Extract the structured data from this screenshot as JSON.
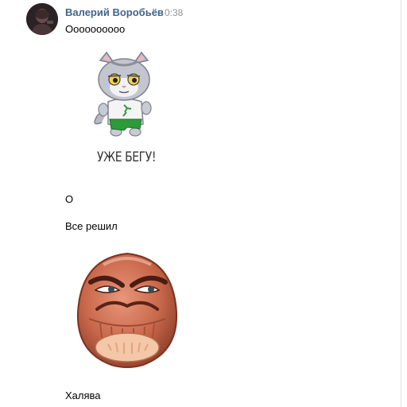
{
  "message_group": {
    "author": "Валерий Воробьёв",
    "time": "0:38"
  },
  "messages": [
    {
      "text": "Оооооооооо"
    },
    {
      "sticker": "cat-running-sticker",
      "caption": "УЖЕ БЕГУ!"
    },
    {
      "text": "О"
    },
    {
      "text": "Все решил"
    },
    {
      "sticker": "grumpy-nut-face-sticker"
    },
    {
      "text": "Халява"
    }
  ],
  "colors": {
    "author_link": "#42648b",
    "time_text": "#939393",
    "message_text": "#000000"
  }
}
